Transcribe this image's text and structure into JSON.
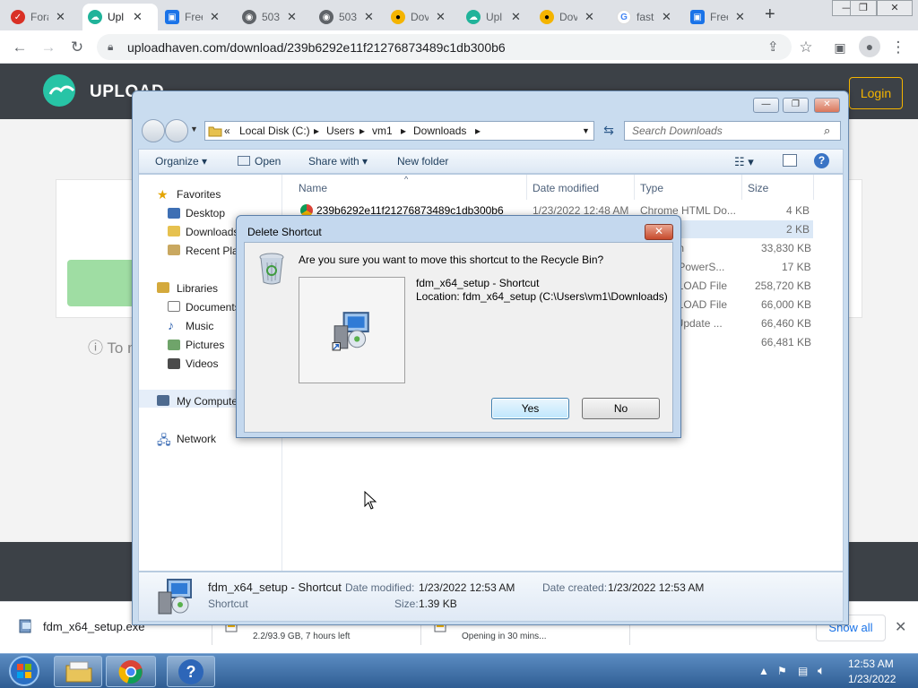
{
  "browser": {
    "tabs": [
      {
        "label": "Fora",
        "favicon_color": "#d93025"
      },
      {
        "label": "Upl",
        "favicon_color": "#20b39a"
      },
      {
        "label": "Free",
        "favicon_color": "#1a73e8"
      },
      {
        "label": "503",
        "favicon_color": "#5f6368"
      },
      {
        "label": "503",
        "favicon_color": "#5f6368"
      },
      {
        "label": "Dov",
        "favicon_color": "#f4b400"
      },
      {
        "label": "Upl",
        "favicon_color": "#20b39a"
      },
      {
        "label": "Dov",
        "favicon_color": "#f4b400"
      },
      {
        "label": "fast",
        "favicon_color": "#4285f4"
      },
      {
        "label": "Free",
        "favicon_color": "#1a73e8"
      }
    ],
    "new_tab": "+",
    "url": "uploadhaven.com/download/239b6292e11f21276873489c1db300b6"
  },
  "site": {
    "logo": "UPLOAD",
    "login_label": "Login",
    "info_text": "To m"
  },
  "explorer": {
    "breadcrumb": [
      "Local Disk (C:)",
      "Users",
      "vm1",
      "Downloads"
    ],
    "search_placeholder": "Search Downloads",
    "commands": {
      "organize": "Organize",
      "open": "Open",
      "share_with": "Share with",
      "new_folder": "New folder"
    },
    "nav": {
      "favorites": "Favorites",
      "desktop": "Desktop",
      "downloads": "Downloads",
      "recent_places": "Recent Plac",
      "libraries": "Libraries",
      "documents": "Documents",
      "music": "Music",
      "pictures": "Pictures",
      "videos": "Videos",
      "my_computer": "My Compute",
      "network": "Network"
    },
    "columns": {
      "name": "Name",
      "date_modified": "Date modified",
      "type": "Type",
      "size": "Size"
    },
    "files": [
      {
        "name": "239b6292e11f21276873489c1db300b6",
        "date": "1/23/2022 12:48 AM",
        "type": "Chrome HTML Do...",
        "size": "4 KB"
      },
      {
        "name": "",
        "date": "",
        "type": "",
        "size": "2 KB"
      },
      {
        "name": "",
        "date": "",
        "type": "ion",
        "size": "33,830 KB"
      },
      {
        "name": "",
        "date": "",
        "type": "s PowerS...",
        "size": "17 KB"
      },
      {
        "name": "",
        "date": "",
        "type": "NLOAD File",
        "size": "258,720 KB"
      },
      {
        "name": "",
        "date": "",
        "type": "NLOAD File",
        "size": "66,000 KB"
      },
      {
        "name": "",
        "date": "",
        "type": "t Update ...",
        "size": "66,460 KB"
      },
      {
        "name": "",
        "date": "",
        "type": "ve",
        "size": "66,481 KB"
      }
    ],
    "details": {
      "name": "fdm_x64_setup - Shortcut",
      "kind": "Shortcut",
      "date_modified_label": "Date modified:",
      "date_modified": "1/23/2022 12:53 AM",
      "size_label": "Size:",
      "size": "1.39 KB",
      "date_created_label": "Date created:",
      "date_created": "1/23/2022 12:53 AM"
    }
  },
  "dialog": {
    "title": "Delete Shortcut",
    "question": "Are you sure you want to move this shortcut to the Recycle Bin?",
    "item_name": "fdm_x64_setup - Shortcut",
    "item_location": "Location: fdm_x64_setup (C:\\Users\\vm1\\Downloads)",
    "yes_label": "Yes",
    "no_label": "No"
  },
  "downloads_bar": {
    "items": [
      {
        "name": "fdm_x64_setup.exe",
        "status": ""
      },
      {
        "name": "",
        "status": "2.2/93.9 GB, 7 hours left"
      },
      {
        "name": "",
        "status": "Opening in 30 mins..."
      }
    ],
    "show_all": "Show all"
  },
  "taskbar": {
    "time": "12:53 AM",
    "date": "1/23/2022"
  }
}
